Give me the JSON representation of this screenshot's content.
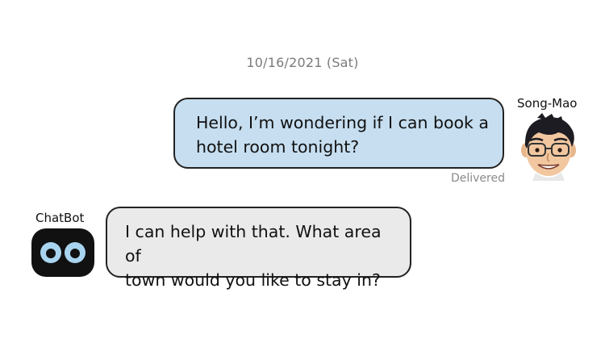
{
  "conversation": {
    "date": "10/16/2021 (Sat)",
    "messages": [
      {
        "sender": "Song-Mao",
        "text": "Hello, I’m wondering if I can book a hotel room tonight?",
        "line1": "Hello, I’m wondering if I can book a",
        "line2": "hotel room tonight?",
        "status": "Delivered",
        "bubble_color": "#c6def0"
      },
      {
        "sender": "ChatBot",
        "text": "I can help with that. What area of town would you like to stay in?",
        "line1": "I can help with that. What area of",
        "line2": "town would you like to stay in?",
        "bubble_color": "#eaeaea"
      }
    ]
  },
  "icons": {
    "user_avatar": "memoji-avatar-icon",
    "bot_avatar": "robot-face-icon"
  }
}
